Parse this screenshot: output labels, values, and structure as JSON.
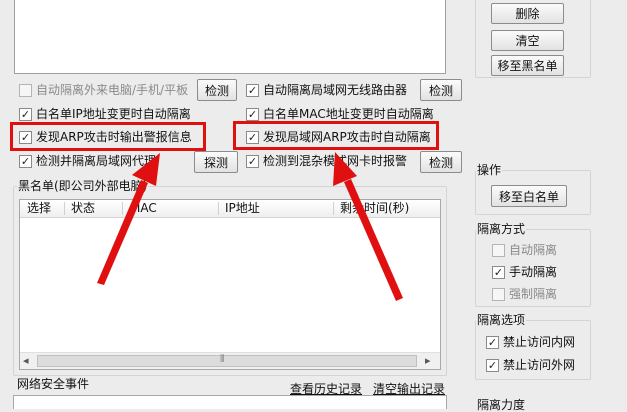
{
  "buttons": {
    "delete": "删除",
    "clear": "清空",
    "move_to_blacklist": "移至黑名单",
    "move_to_whitelist": "移至白名单"
  },
  "options": {
    "auto_isolate_external": {
      "label": "自动隔离外来电脑/手机/平板",
      "checked": false,
      "enabled": false,
      "button": "检测"
    },
    "auto_isolate_wireless_router": {
      "label": "自动隔离局域网无线路由器",
      "checked": true,
      "enabled": true,
      "button": "检测"
    },
    "whitelist_ip_change": {
      "label": "白名单IP地址变更时自动隔离",
      "checked": true,
      "enabled": true
    },
    "whitelist_mac_change": {
      "label": "白名单MAC地址变更时自动隔离",
      "checked": true,
      "enabled": true
    },
    "arp_attack_alert": {
      "label": "发现ARP攻击时输出警报信息",
      "checked": true,
      "enabled": true
    },
    "lan_arp_attack_isolate": {
      "label": "发现局域网ARP攻击时自动隔离",
      "checked": true,
      "enabled": true
    },
    "detect_isolate_proxy": {
      "label": "检测并隔离局域网代理",
      "checked": true,
      "enabled": true,
      "button": "探测"
    },
    "promiscuous_nic_alert": {
      "label": "检测到混杂模式网卡时报警",
      "checked": true,
      "enabled": true,
      "button": "检测"
    }
  },
  "blacklist": {
    "title": "黑名单(即公司外部电脑)",
    "columns": [
      "选择",
      "状态",
      "MAC",
      "IP地址",
      "剩余时间(秒)"
    ]
  },
  "operations": {
    "title": "操作"
  },
  "isolation_mode": {
    "title": "隔离方式",
    "items": [
      {
        "label": "自动隔离",
        "checked": false
      },
      {
        "label": "手动隔离",
        "checked": true
      },
      {
        "label": "强制隔离",
        "checked": false
      }
    ]
  },
  "isolation_options": {
    "title": "隔离选项",
    "items": [
      {
        "label": "禁止访问内网",
        "checked": true
      },
      {
        "label": "禁止访问外网",
        "checked": true
      }
    ]
  },
  "isolation_strength": {
    "title": "隔离力度"
  },
  "events": {
    "title": "网络安全事件",
    "view_history": "查看历史记录",
    "clear_output": "清空输出记录"
  },
  "colors": {
    "annotation_red": "#e01010"
  },
  "icons": {
    "check": "✓",
    "scroll_left": "◂",
    "scroll_right": "▸",
    "grip": "⦀"
  }
}
